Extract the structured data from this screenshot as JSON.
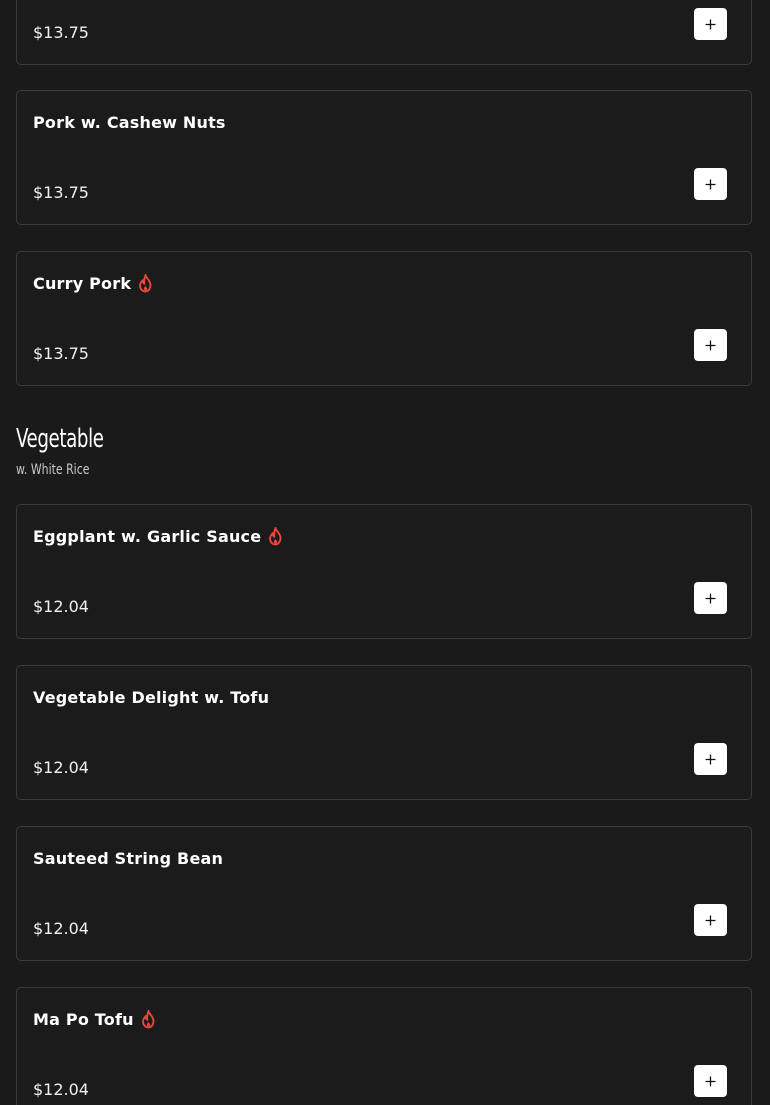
{
  "items": [
    {
      "name": "",
      "price": "$13.75",
      "spicy": false
    },
    {
      "name": "Pork w. Cashew Nuts",
      "price": "$13.75",
      "spicy": false
    },
    {
      "name": "Curry Pork",
      "price": "$13.75",
      "spicy": true
    },
    {
      "name": "Eggplant w. Garlic Sauce",
      "price": "$12.04",
      "spicy": true
    },
    {
      "name": "Vegetable Delight w. Tofu",
      "price": "$12.04",
      "spicy": false
    },
    {
      "name": "Sauteed String Bean",
      "price": "$12.04",
      "spicy": false
    },
    {
      "name": "Ma Po Tofu",
      "price": "$12.04",
      "spicy": true
    }
  ],
  "section": {
    "title": "Vegetable",
    "subtitle": "w. White Rice"
  },
  "colors": {
    "background": "#1a1a1a",
    "card_border": "#3b3b3b",
    "spicy": "#e8473c",
    "button_bg": "#ffffff"
  },
  "icons": {
    "add": "plus-icon",
    "spicy": "fire-icon"
  }
}
